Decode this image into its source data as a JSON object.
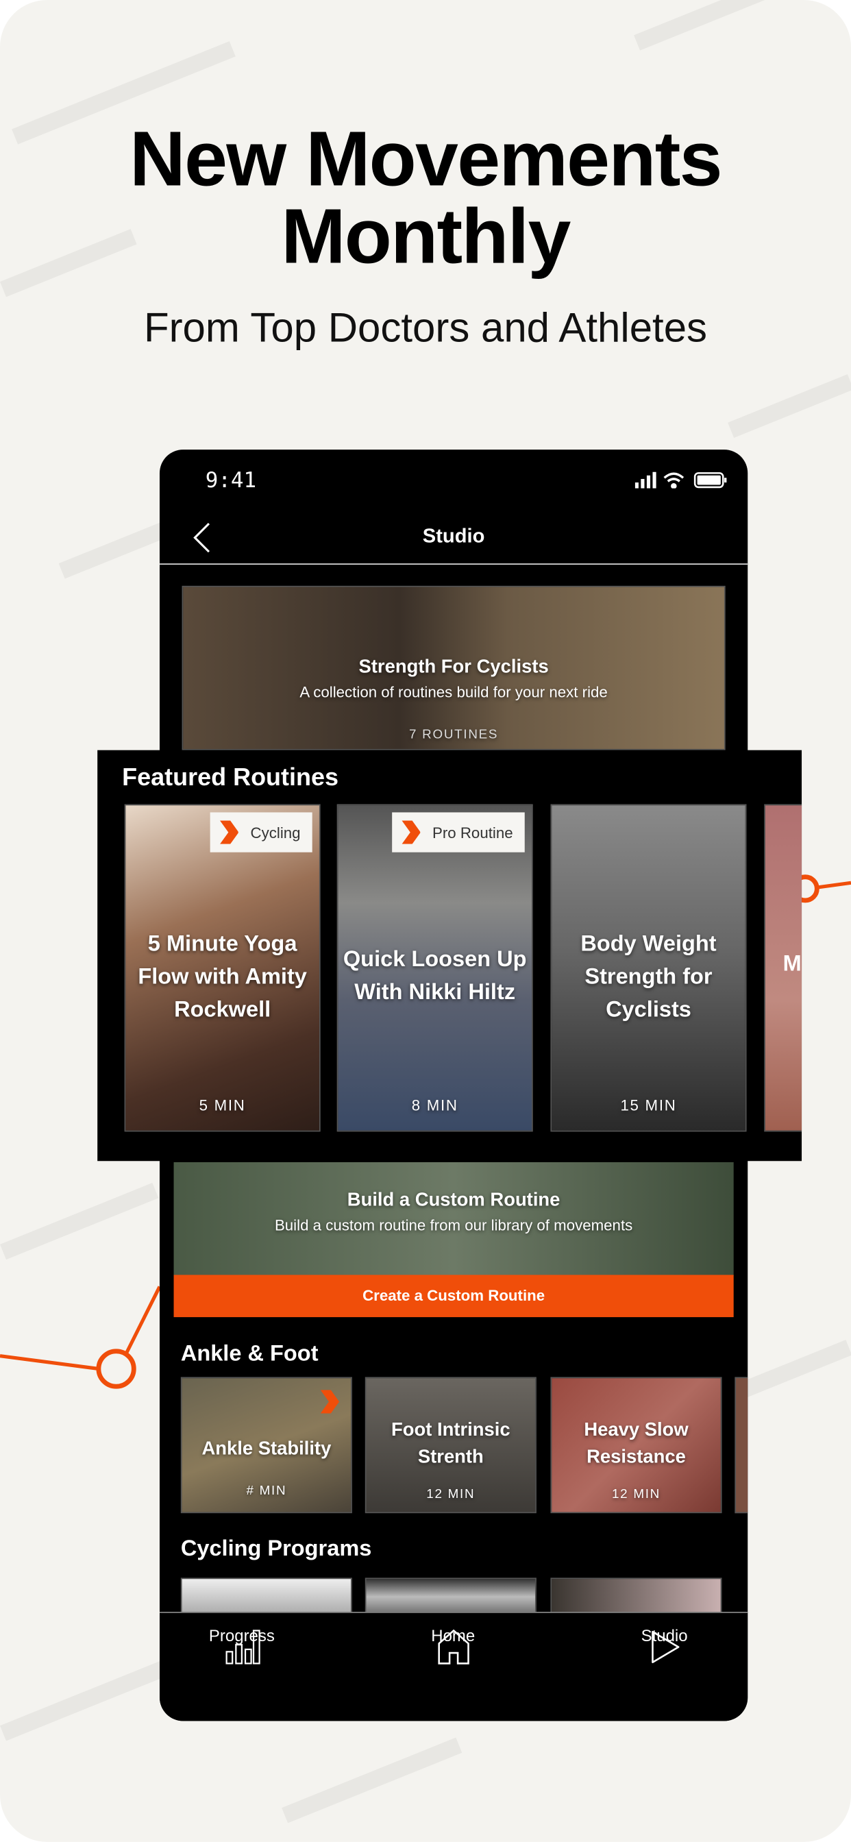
{
  "headline": {
    "line1": "New Movements",
    "line2": "Monthly",
    "subtitle": "From Top Doctors and Athletes"
  },
  "colors": {
    "accent": "#f04e0a",
    "background": "#f4f3ef"
  },
  "status_bar": {
    "time": "9:41",
    "icons": [
      "signal-icon",
      "wifi-icon",
      "battery-icon"
    ]
  },
  "nav": {
    "title": "Studio",
    "back_icon": "chevron-left-icon"
  },
  "hero": {
    "title": "Strength For Cyclists",
    "subtitle": "A collection of routines build for your next ride",
    "count": "7 ROUTINES"
  },
  "featured": {
    "title": "Featured Routines",
    "cards": [
      {
        "title": "5 Minute Yoga Flow with Amity Rockwell",
        "duration": "5 MIN",
        "badge": "Cycling"
      },
      {
        "title": "Quick Loosen Up With Nikki Hiltz",
        "duration": "8 MIN",
        "badge": "Pro Routine"
      },
      {
        "title": "Body Weight Strength for Cyclists",
        "duration": "15 MIN"
      },
      {
        "title": "M"
      }
    ]
  },
  "custom": {
    "title": "Build a Custom Routine",
    "subtitle": "Build a custom routine from our library of movements",
    "button": "Create a Custom Routine"
  },
  "ankle": {
    "title": "Ankle & Foot",
    "cards": [
      {
        "title": "Ankle Stability",
        "duration": "# MIN"
      },
      {
        "title": "Foot Intrinsic Strenth",
        "duration": "12 MIN"
      },
      {
        "title": "Heavy Slow Resistance",
        "duration": "12 MIN"
      }
    ]
  },
  "cycling": {
    "title": "Cycling Programs"
  },
  "tabs": [
    {
      "label": "Progress",
      "icon": "bar-chart-icon"
    },
    {
      "label": "Home",
      "icon": "home-icon"
    },
    {
      "label": "Studio",
      "icon": "play-icon"
    }
  ]
}
